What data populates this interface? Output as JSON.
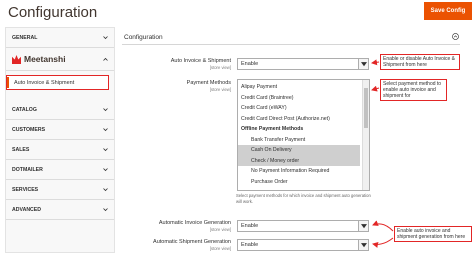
{
  "page": {
    "title": "Configuration"
  },
  "header": {
    "save_label": "Save Config"
  },
  "sidebar": {
    "general": "GENERAL",
    "vendor": "Meetanshi",
    "active_item": "Auto Invoice & Shipment",
    "sections": [
      "CATALOG",
      "CUSTOMERS",
      "SALES",
      "DOTMAILER",
      "SERVICES",
      "ADVANCED"
    ]
  },
  "main": {
    "section_title": "Configuration",
    "fields": {
      "auto_invoice": {
        "label": "Auto Invoice & Shipment",
        "scope": "[store view]",
        "value": "Enable"
      },
      "payment_methods": {
        "label": "Payment Methods",
        "scope": "[store view]",
        "options": [
          {
            "text": "Alipay Payment",
            "type": "option",
            "selected": false,
            "indent": false
          },
          {
            "text": "Credit Card (Braintree)",
            "type": "option",
            "selected": false,
            "indent": false
          },
          {
            "text": "Credit Card (eWAY)",
            "type": "option",
            "selected": false,
            "indent": false
          },
          {
            "text": "Credit Card Direct Post (Authorize.net)",
            "type": "option",
            "selected": false,
            "indent": false
          },
          {
            "text": "Offline Payment Methods",
            "type": "group",
            "selected": false,
            "indent": false
          },
          {
            "text": "Bank Transfer Payment",
            "type": "option",
            "selected": false,
            "indent": true
          },
          {
            "text": "Cash On Delivery",
            "type": "option",
            "selected": true,
            "indent": true
          },
          {
            "text": "Check / Money order",
            "type": "option",
            "selected": true,
            "indent": true
          },
          {
            "text": "No Payment Information Required",
            "type": "option",
            "selected": false,
            "indent": true
          },
          {
            "text": "Purchase Order",
            "type": "option",
            "selected": false,
            "indent": true
          }
        ],
        "note": "Select payment methods for which invoice and shipment auto generation will work."
      },
      "auto_invoice_generation": {
        "label": "Automatic Invoice Generation",
        "scope": "[store view]",
        "value": "Enable"
      },
      "auto_shipment_generation": {
        "label": "Automatic Shipment Generation",
        "scope": "[store view]",
        "value": "Enable"
      }
    }
  },
  "callouts": {
    "enable": "Enable or disable Auto Invoice & Shipment from here",
    "payment": "Select payment method to enable auto invoice and shipment for",
    "generation": "Enable auto invoice and shipment generation from here"
  },
  "colors": {
    "accent": "#eb5202",
    "callout_border": "#e22626",
    "arrow": "#e22626"
  }
}
